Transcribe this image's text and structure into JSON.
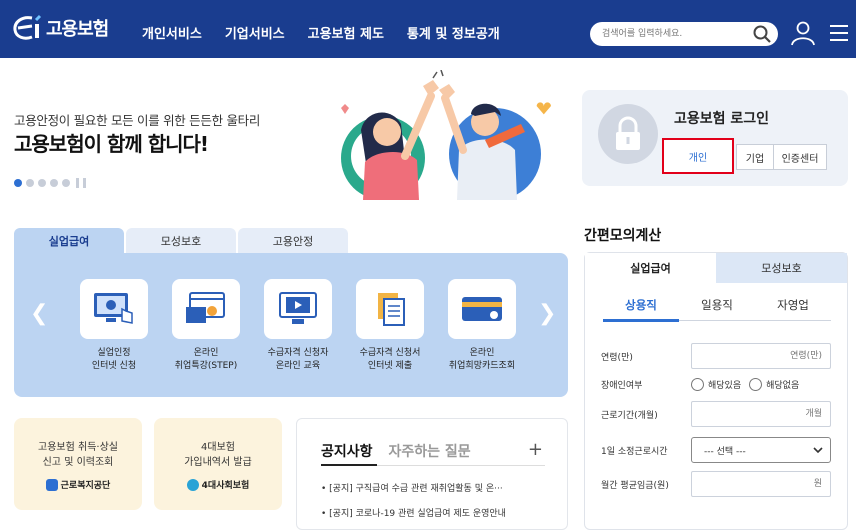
{
  "header": {
    "logo_text": "고용보험",
    "nav": [
      "개인서비스",
      "기업서비스",
      "고용보험 제도",
      "통계 및 정보공개"
    ],
    "search_placeholder": "검색어를 입력하세요.",
    "icons": [
      "search-icon",
      "user-icon",
      "menu-icon"
    ]
  },
  "hero": {
    "subtitle": "고용안정이 필요한 모든 이를 위한 든든한 울타리",
    "title": "고용보험이 함께 합니다!",
    "slide_count": 5,
    "active_slide": 1
  },
  "login": {
    "title": "고용보험 로그인",
    "buttons": [
      "개인",
      "기업",
      "인증센터"
    ]
  },
  "services": {
    "tabs": [
      "실업급여",
      "모성보호",
      "고용안정"
    ],
    "active_tab": "실업급여",
    "items": [
      {
        "label": "실업인정\n인터넷 신청",
        "icon": "monitor-hand-icon"
      },
      {
        "label": "온라인\n취업특강(STEP)",
        "icon": "video-window-icon"
      },
      {
        "label": "수급자격 신청자\n온라인 교육",
        "icon": "play-monitor-icon"
      },
      {
        "label": "수급자격 신청서\n인터넷 제출",
        "icon": "document-icon"
      },
      {
        "label": "온라인\n취업희망카드조회",
        "icon": "card-icon"
      }
    ]
  },
  "shortcuts": [
    {
      "text": "고용보험 취득·상실\n신고 및 이력조회",
      "org": "근로복지공단"
    },
    {
      "text": "4대보험\n가입내역서 발급",
      "org": "4대사회보험"
    }
  ],
  "notice": {
    "tabs": [
      "공지사항",
      "자주하는 질문"
    ],
    "items": [
      "[공지] 구직급여 수급 관련 재취업활동 및 온···",
      "[공지] 코로나-19 관련 실업급여 제도 운영안내"
    ]
  },
  "calculator": {
    "title": "간편모의계산",
    "tabs": [
      "실업급여",
      "모성보호"
    ],
    "subtabs": [
      "상용직",
      "일용직",
      "자영업"
    ],
    "fields": {
      "age_label": "연령(만)",
      "age_placeholder": "연령(만)",
      "disabled_label": "장애인여부",
      "disabled_yes": "해당있음",
      "disabled_no": "해당없음",
      "period_label": "근로기간(개월)",
      "period_placeholder": "개월",
      "hours_label": "1일 소정근로시간",
      "hours_select": "--- 선택 ---",
      "wage_label": "월간 평균임금(원)",
      "wage_placeholder": "원"
    }
  },
  "colors": {
    "header_bg": "#1a3d8f",
    "accent": "#2d6fd2",
    "highlight_box": "#e2001a",
    "panel": "#bcd4f2"
  }
}
